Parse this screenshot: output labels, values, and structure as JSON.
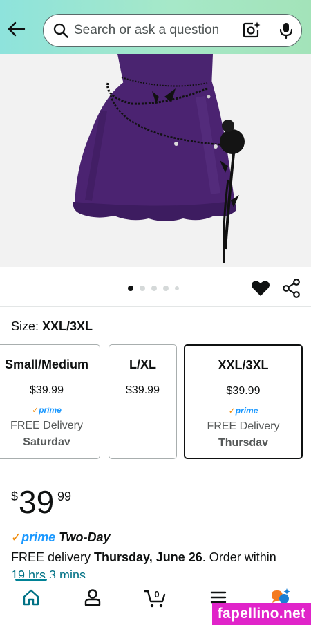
{
  "header": {
    "search_placeholder": "Search or ask a question"
  },
  "carousel": {
    "dot_count": 5,
    "active_index": 0
  },
  "size": {
    "label": "Size: ",
    "selected": "XXL/3XL",
    "options": [
      {
        "name": "Small/Medium",
        "price": "$39.99",
        "prime": "prime",
        "delivery": "FREE Delivery",
        "day": "Saturdav"
      },
      {
        "name": "L/XL",
        "price": "$39.99"
      },
      {
        "name": "XXL/3XL",
        "price": "$39.99",
        "prime": "prime",
        "delivery": "FREE Delivery",
        "day": "Thursdav"
      }
    ]
  },
  "price": {
    "symbol": "$",
    "whole": "39",
    "fraction": "99"
  },
  "prime_delivery": {
    "check": "✓",
    "prime": "prime",
    "speed": "Two-Day"
  },
  "delivery": {
    "prefix": "FREE delivery ",
    "date": "Thursday, June 26",
    "suffix": ". Order within",
    "countdown": "19 hrs 3 mins"
  },
  "watermark": "fapellino.net",
  "colors": {
    "header_gradient_start": "#8ee3dc",
    "header_gradient_end": "#a3e3b9",
    "prime_blue": "#1a98ff",
    "prime_check_orange": "#f08804",
    "link_teal": "#007185",
    "nav_active": "#008296",
    "skirt_purple": "#4b2371",
    "watermark_bg": "#e024c9"
  },
  "icons": {
    "back": "arrow-left-icon",
    "search": "search-icon",
    "camera": "camera-sparkle-icon",
    "mic": "microphone-icon",
    "heart": "heart-icon",
    "share": "share-icon",
    "home": "home-icon",
    "account": "person-icon",
    "cart": "cart-icon",
    "menu": "menu-icon",
    "rufus": "chat-sparkle-icon"
  },
  "cart": {
    "count": "0"
  }
}
